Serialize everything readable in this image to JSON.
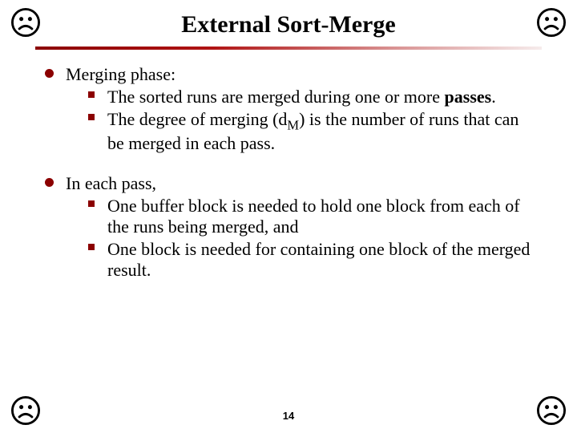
{
  "icon_name": "sad-face-icon",
  "icon_color": "#000000",
  "title": "External Sort-Merge",
  "accent_color": "#8b0000",
  "bullets": [
    {
      "lead": "Merging phase:",
      "subs": [
        {
          "pre": "The sorted runs are merged during one or more ",
          "bold": "passes",
          "post": "."
        },
        {
          "pre": "The degree of merging (d",
          "sub": "M",
          "post2": ") is the number of runs that can be merged in each pass."
        }
      ]
    },
    {
      "lead": "In each pass,",
      "subs": [
        {
          "text": "One buffer block is needed to hold one block from each of the runs being merged, and"
        },
        {
          "text": "One block is needed for containing one block of the merged result."
        }
      ]
    }
  ],
  "page_number": "14"
}
